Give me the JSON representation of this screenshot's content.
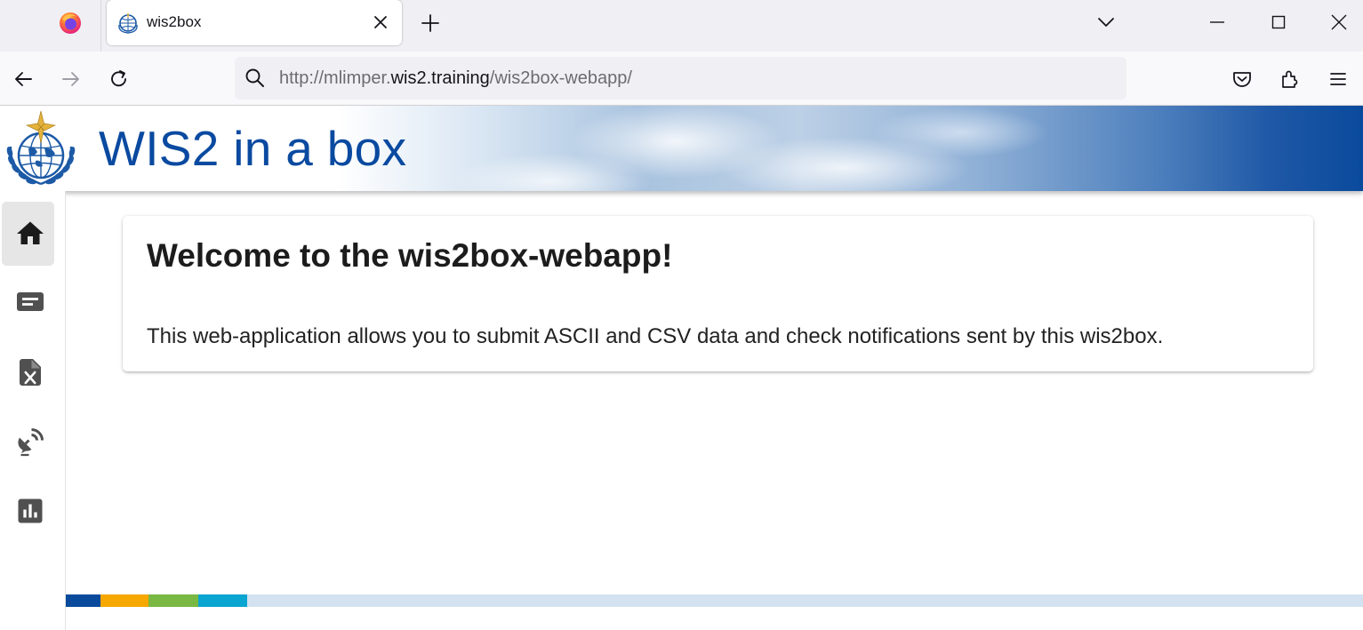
{
  "browser": {
    "tab": {
      "title": "wis2box"
    },
    "url": {
      "prefix": "http://mlimper.",
      "host": "wis2.training",
      "path": "/wis2box-webapp/"
    }
  },
  "header": {
    "title": "WIS2 in a box",
    "logo": "wmo-emblem"
  },
  "sidebar": {
    "items": [
      {
        "icon": "home-icon",
        "active": true
      },
      {
        "icon": "message-icon",
        "active": false
      },
      {
        "icon": "csv-file-icon",
        "active": false
      },
      {
        "icon": "satellite-dish-icon",
        "active": false
      },
      {
        "icon": "bar-chart-icon",
        "active": false
      }
    ]
  },
  "main": {
    "card": {
      "heading": "Welcome to the wis2box-webapp!",
      "text": "This web-application allows you to submit ASCII and CSV data and check notifications sent by this wis2box."
    }
  },
  "footer": {
    "strip_colors": [
      "#0a4a9c",
      "#f6a700",
      "#79b842",
      "#0aa5d0",
      "#d3e2f0"
    ]
  },
  "colors": {
    "brand_blue": "#0a4aa0",
    "sidebar_icon": "#505050",
    "active_item_bg": "#e6e6e6"
  }
}
